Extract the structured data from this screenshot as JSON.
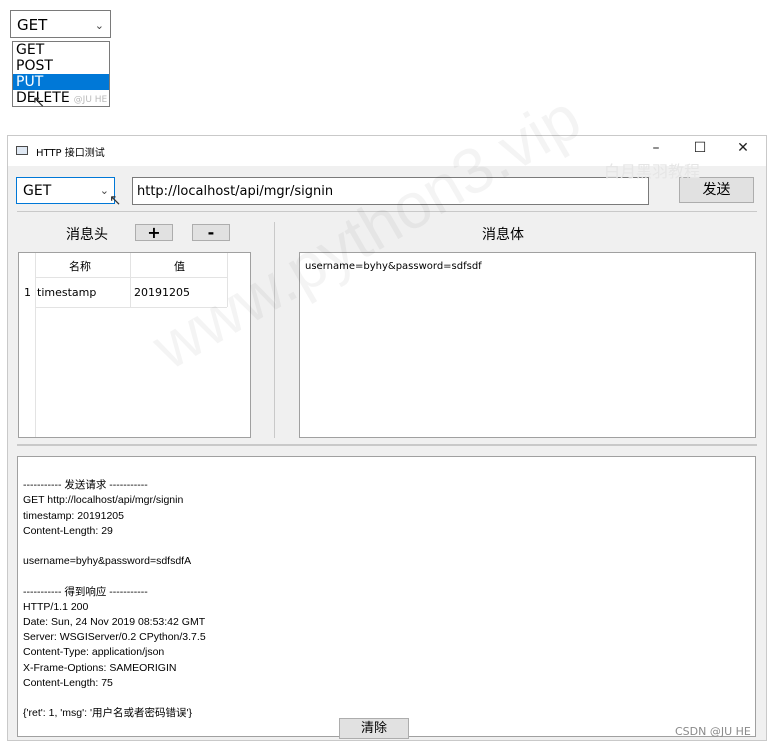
{
  "dropdown_demo": {
    "selected": "GET",
    "options": [
      "GET",
      "POST",
      "PUT",
      "DELETE"
    ],
    "highlighted_index": 2,
    "watermark": "@JU HE"
  },
  "window": {
    "title": "HTTP 接口测试",
    "controls": {
      "minimize": "–",
      "maximize": "☐",
      "close": "✕"
    },
    "method": "GET",
    "url": "http://localhost/api/mgr/signin",
    "send_label": "发送",
    "headers_title": "消息头",
    "add_label": "+",
    "remove_label": "-",
    "body_title": "消息体",
    "table": {
      "columns": [
        "名称",
        "值"
      ],
      "rows": [
        {
          "num": "1",
          "name": "timestamp",
          "value": "20191205"
        }
      ]
    },
    "body_text": "username=byhy&password=sdfsdf",
    "response_lines": [
      "----------- 发送请求 -----------",
      "GET http://localhost/api/mgr/signin",
      "timestamp: 20191205",
      "Content-Length: 29",
      "",
      "username=byhy&password=sdfsdfA",
      "",
      "----------- 得到响应 -----------",
      "HTTP/1.1 200",
      "Date: Sun, 24 Nov 2019 08:53:42 GMT",
      "Server: WSGIServer/0.2 CPython/3.7.5",
      "Content-Type: application/json",
      "X-Frame-Options: SAMEORIGIN",
      "Content-Length: 75",
      "",
      "{'ret': 1, 'msg': '用户名或者密码错误'}"
    ],
    "clear_label": "清除"
  },
  "watermarks": {
    "main": "www.python3.vip",
    "top_right": "白月黑羽教程",
    "csdn": "CSDN @JU HE"
  }
}
